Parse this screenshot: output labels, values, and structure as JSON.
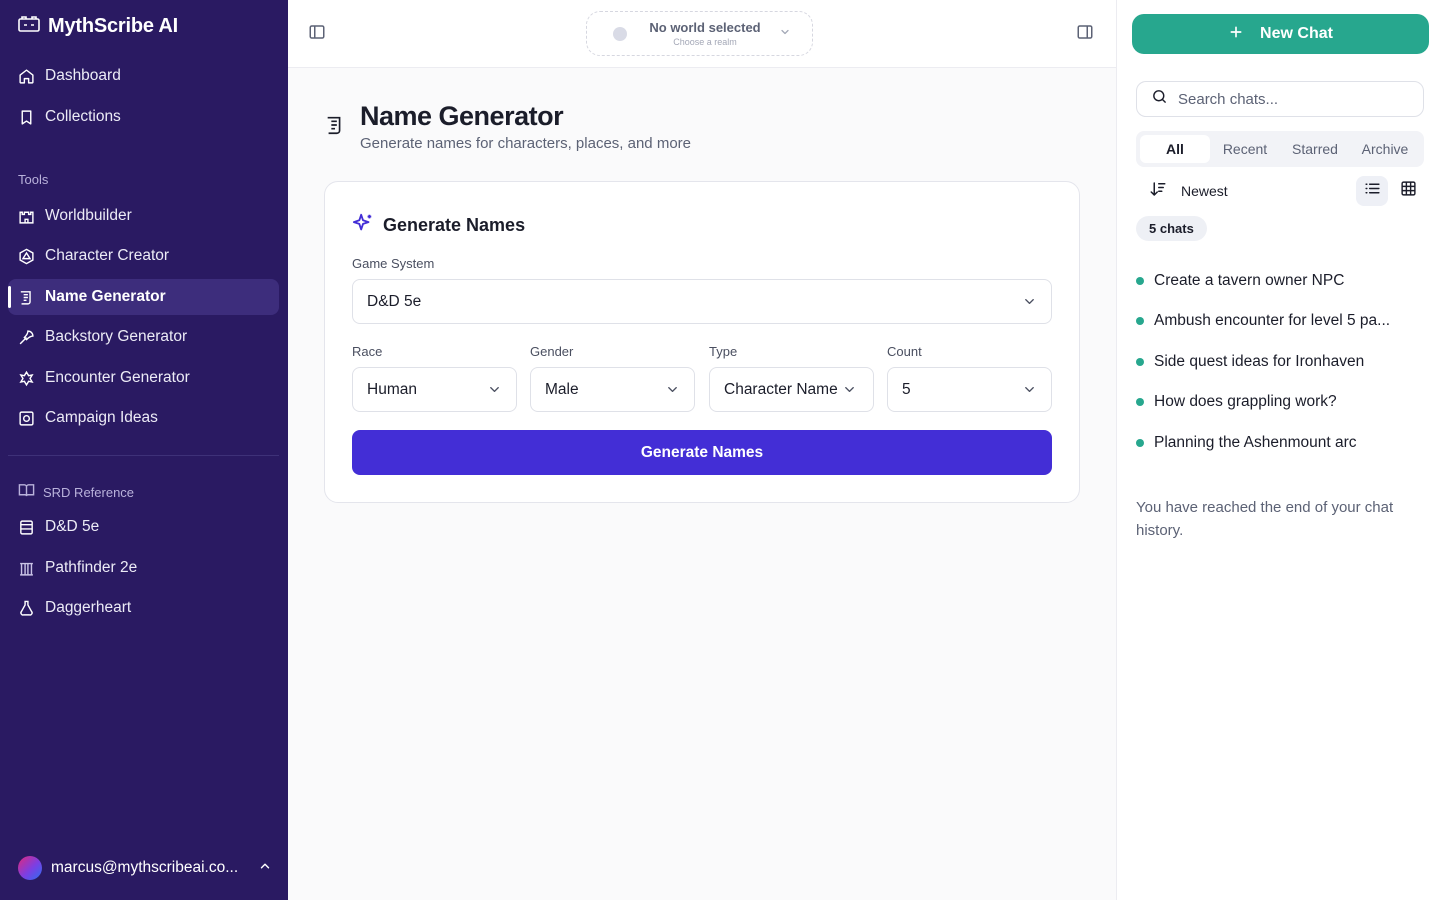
{
  "sidebar": {
    "brand": "MythScribe AI",
    "nav_main": [
      {
        "label": "Dashboard"
      },
      {
        "label": "Collections"
      }
    ],
    "tools_label": "Tools",
    "tools": [
      {
        "label": "Worldbuilder"
      },
      {
        "label": "Character Creator"
      },
      {
        "label": "Name Generator",
        "active": true
      },
      {
        "label": "Backstory Generator"
      },
      {
        "label": "Encounter Generator"
      },
      {
        "label": "Campaign Ideas"
      }
    ],
    "srd_label": "SRD Reference",
    "srd": [
      {
        "label": "D&D 5e"
      },
      {
        "label": "Pathfinder 2e"
      },
      {
        "label": "Daggerheart"
      }
    ],
    "user_email": "marcus@mythscribeai.co..."
  },
  "topbar": {
    "world_title": "No world selected",
    "world_sub": "Choose a realm"
  },
  "page": {
    "title": "Name Generator",
    "subtitle": "Generate names for characters, places, and more"
  },
  "form": {
    "card_title": "Generate Names",
    "game_system_label": "Game System",
    "game_system_value": "D&D 5e",
    "race_label": "Race",
    "race_value": "Human",
    "gender_label": "Gender",
    "gender_value": "Male",
    "type_label": "Type",
    "type_value": "Character Name",
    "count_label": "Count",
    "count_value": "5",
    "submit_label": "Generate Names"
  },
  "chat_panel": {
    "new_chat_label": "New Chat",
    "search_placeholder": "Search chats...",
    "tabs": [
      "All",
      "Recent",
      "Starred",
      "Archive"
    ],
    "sort_label": "Newest",
    "count_label": "5 chats",
    "chats": [
      "Create a tavern owner NPC",
      "Ambush encounter for level 5 pa...",
      "Side quest ideas for Ironhaven",
      "How does grappling work?",
      "Planning the Ashenmount arc"
    ],
    "end_note": "You have reached the end of your chat history."
  },
  "colors": {
    "sidebar_bg": "#2a1a62",
    "accent_primary": "#432ed6",
    "accent_teal": "#27a78e"
  }
}
